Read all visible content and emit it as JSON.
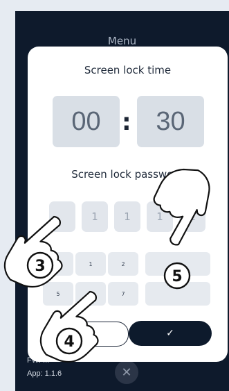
{
  "menu": {
    "title": "Menu"
  },
  "lock_time": {
    "title": "Screen lock time",
    "left": "00",
    "separator": ":",
    "right": "30"
  },
  "password": {
    "title": "Screen lock password",
    "digits": [
      "",
      "1",
      "1",
      "1",
      "1"
    ]
  },
  "keypad": {
    "row1": [
      "1",
      "2"
    ],
    "row2": [
      "5",
      "7"
    ]
  },
  "actions": {
    "confirm_icon": "check-icon",
    "close_icon": "close-icon"
  },
  "footer": {
    "fw": "FW: ...",
    "app": "App: 1.1.6"
  },
  "callouts": [
    "3",
    "4",
    "5"
  ],
  "colors": {
    "device": "#0e1a2c",
    "panel": "#ffffff",
    "accent": "#0d1a2c"
  }
}
